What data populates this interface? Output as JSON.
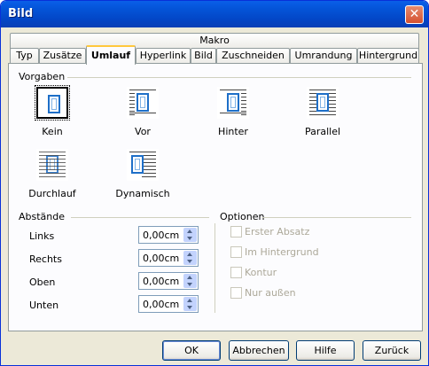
{
  "window": {
    "title": "Bild",
    "close_symbol": "✕"
  },
  "tabs": {
    "row1": [
      {
        "label": "Makro"
      }
    ],
    "row2": [
      {
        "label": "Typ"
      },
      {
        "label": "Zusätze"
      },
      {
        "label": "Umlauf",
        "active": true
      },
      {
        "label": "Hyperlink"
      },
      {
        "label": "Bild"
      },
      {
        "label": "Zuschneiden"
      },
      {
        "label": "Umrandung"
      },
      {
        "label": "Hintergrund"
      }
    ]
  },
  "vorgaben": {
    "title": "Vorgaben",
    "items": [
      {
        "label": "Kein",
        "selected": true,
        "icon": "wrap-none-icon"
      },
      {
        "label": "Vor",
        "icon": "wrap-before-icon"
      },
      {
        "label": "Hinter",
        "icon": "wrap-after-icon"
      },
      {
        "label": "Parallel",
        "icon": "wrap-parallel-icon"
      },
      {
        "label": "Durchlauf",
        "icon": "wrap-through-icon"
      },
      {
        "label": "Dynamisch",
        "icon": "wrap-optimal-icon"
      }
    ]
  },
  "abstaende": {
    "title": "Abstände",
    "fields": [
      {
        "label": "Links",
        "value": "0,00cm"
      },
      {
        "label": "Rechts",
        "value": "0,00cm"
      },
      {
        "label": "Oben",
        "value": "0,00cm"
      },
      {
        "label": "Unten",
        "value": "0,00cm"
      }
    ]
  },
  "optionen": {
    "title": "Optionen",
    "items": [
      {
        "label": "Erster Absatz",
        "checked": false,
        "enabled": false
      },
      {
        "label": "Im Hintergrund",
        "checked": false,
        "enabled": false
      },
      {
        "label": "Kontur",
        "checked": false,
        "enabled": false
      },
      {
        "label": "Nur außen",
        "checked": false,
        "enabled": false
      }
    ]
  },
  "buttons": {
    "ok": "OK",
    "cancel": "Abbrechen",
    "help": "Hilfe",
    "reset": "Zurück"
  }
}
